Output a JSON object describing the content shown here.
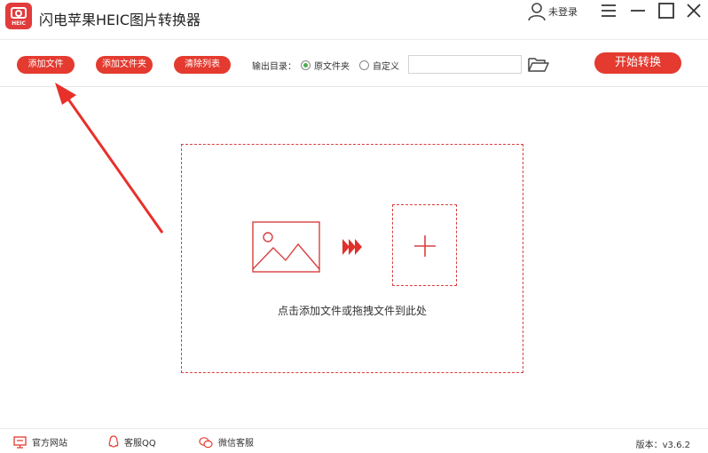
{
  "window": {
    "title": "闪电苹果HEIC图片转换器",
    "logo_tag": "HEIC",
    "login_label": "未登录"
  },
  "toolbar": {
    "add_file_label": "添加文件",
    "add_folder_label": "添加文件夹",
    "clear_list_label": "清除列表",
    "output_dir_label": "输出目录：",
    "output_options": [
      "原文件夹",
      "自定义"
    ],
    "selected_output": "原文件夹",
    "path_value": "",
    "start_label": "开始转换"
  },
  "dropzone": {
    "hint": "点击添加文件或拖拽文件到此处"
  },
  "footer": {
    "website_label": "官方网站",
    "qq_label": "客服QQ",
    "wechat_label": "微信客服",
    "version": "版本：v3.6.2"
  },
  "icons": {
    "logo": "camera-logo-icon",
    "login": "user-icon",
    "menu": "hamburger-icon",
    "minimize": "minimize-icon",
    "maximize": "maximize-icon",
    "close": "close-icon",
    "folder": "folder-open-icon",
    "image": "image-icon",
    "arrows": "triple-chevron-icon",
    "add": "plus-icon",
    "website": "monitor-icon",
    "qq": "qq-icon",
    "wechat": "wechat-icon"
  },
  "colors": {
    "accent": "#e43a2f",
    "dashed_border": "#d84040",
    "radio_selected": "#4caf50"
  }
}
